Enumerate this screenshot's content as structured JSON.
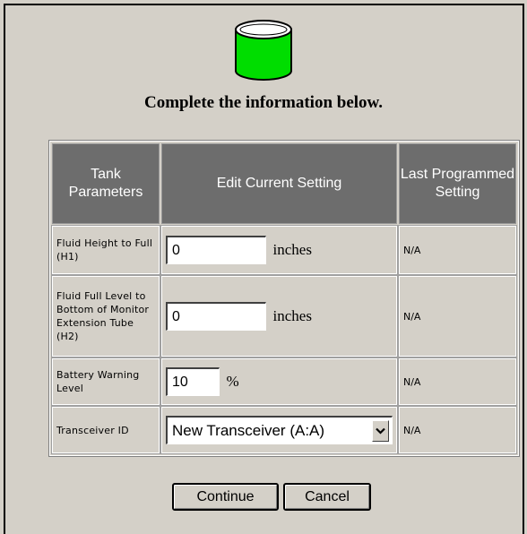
{
  "icon": {
    "name": "tank-icon",
    "fill_color": "#00dd00"
  },
  "heading": "Complete the information below.",
  "table": {
    "headers": [
      "Tank Parameters",
      "Edit Current Setting",
      "Last Programmed Setting"
    ],
    "rows": [
      {
        "label": "Fluid Height to Full (H1)",
        "value": "0",
        "unit": "inches",
        "last": "N/A"
      },
      {
        "label": "Fluid Full Level to Bottom of Monitor Extension Tube (H2)",
        "value": "0",
        "unit": "inches",
        "last": "N/A"
      },
      {
        "label": "Battery Warning Level",
        "value": "10",
        "unit": "%",
        "last": "N/A"
      },
      {
        "label": "Transceiver ID",
        "value": "New Transceiver (A:A)",
        "last": "N/A"
      }
    ]
  },
  "buttons": {
    "continue": "Continue",
    "cancel": "Cancel"
  }
}
